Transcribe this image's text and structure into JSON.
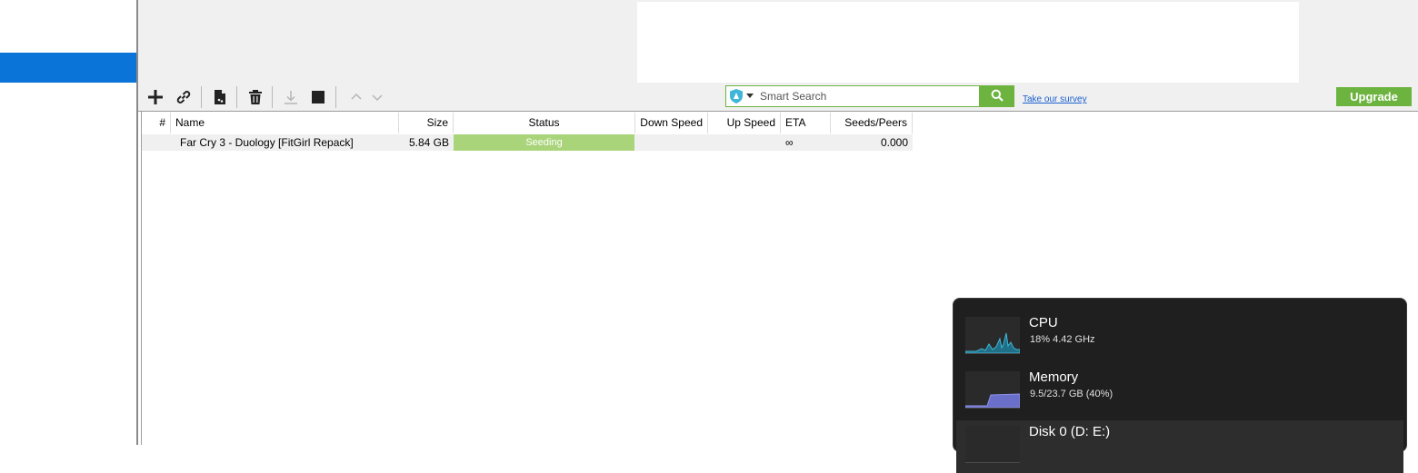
{
  "toolbar": {
    "buttons": [
      {
        "name": "add-torrent-button",
        "icon": "plus-icon"
      },
      {
        "name": "add-link-button",
        "icon": "link-icon"
      },
      {
        "name": "create-torrent-button",
        "icon": "new-file-icon"
      },
      {
        "name": "remove-torrent-button",
        "icon": "trash-icon"
      },
      {
        "name": "start-button",
        "icon": "download-icon"
      },
      {
        "name": "stop-button",
        "icon": "stop-icon"
      },
      {
        "name": "move-up-button",
        "icon": "chevron-up-icon"
      },
      {
        "name": "move-down-button",
        "icon": "chevron-down-icon"
      }
    ],
    "search_placeholder": "Smart Search",
    "survey_link": "Take our survey",
    "upgrade_label": "Upgrade",
    "accent_color": "#6db33f"
  },
  "table": {
    "columns": [
      "#",
      "Name",
      "Size",
      "Status",
      "Down Speed",
      "Up Speed",
      "ETA",
      "Seeds/Peers"
    ],
    "rows": [
      {
        "number": "",
        "name": "Far Cry 3 - Duology [FitGirl Repack]",
        "size": "5.84 GB",
        "status": "Seeding",
        "down_speed": "",
        "up_speed": "",
        "eta": "∞",
        "seeds_peers": "0.000"
      }
    ]
  },
  "performance": {
    "items": [
      {
        "title": "CPU",
        "subtitle": "18%  4.42 GHz",
        "color": "#3fb6d8"
      },
      {
        "title": "Memory",
        "subtitle": "9.5/23.7 GB (40%)",
        "color": "#7b82d6"
      },
      {
        "title": "Disk 0 (D: E:)",
        "subtitle": "",
        "color": "#5fbf5f"
      }
    ]
  },
  "colors": {
    "sidebar_selected": "#0a74d8",
    "status_seeding": "#a9d47a",
    "flyout_bg": "#1f1f1f"
  }
}
